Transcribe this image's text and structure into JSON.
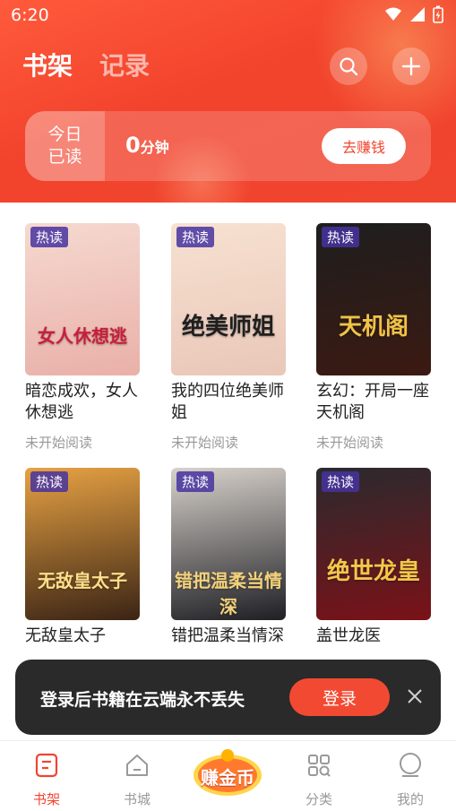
{
  "status_bar": {
    "time": "6:20"
  },
  "header": {
    "tabs": [
      {
        "label": "书架"
      },
      {
        "label": "记录"
      }
    ],
    "today_read": {
      "label_line1": "今日",
      "label_line2": "已读",
      "value": "0",
      "unit": "分钟",
      "earn_button": "去赚钱"
    }
  },
  "books": [
    {
      "title": "暗恋成欢，女人休想逃",
      "status": "未开始阅读",
      "tag": "热读",
      "cover_text": "女人休想逃",
      "cover_colors": [
        "#f5d9cf",
        "#e9b0a9"
      ],
      "cover_text_color": "#c81e3a"
    },
    {
      "title": "我的四位绝美师姐",
      "status": "未开始阅读",
      "tag": "热读",
      "cover_text": "绝美师姐",
      "cover_colors": [
        "#f7e1d1",
        "#e9c7b8"
      ],
      "cover_text_color": "#1f1f1f"
    },
    {
      "title": "玄幻：开局一座天机阁",
      "status": "未开始阅读",
      "tag": "热读",
      "cover_text": "天机阁",
      "cover_colors": [
        "#1e1e1e",
        "#3b1a12"
      ],
      "cover_text_color": "#f0c347"
    },
    {
      "title": "无敌皇太子",
      "status": "",
      "tag": "热读",
      "cover_text": "无敌皇太子",
      "cover_colors": [
        "#e7a243",
        "#3b2415"
      ],
      "cover_text_color": "#ffe08a"
    },
    {
      "title": "错把温柔当情深",
      "status": "",
      "tag": "热读",
      "cover_text": "错把温柔当情深",
      "cover_colors": [
        "#d8d2cb",
        "#1f1f24"
      ],
      "cover_text_color": "#f3d27a"
    },
    {
      "title": "盖世龙医",
      "status": "",
      "tag": "热读",
      "cover_text": "绝世龙皇",
      "cover_colors": [
        "#2a2a2e",
        "#7a1218"
      ],
      "cover_text_color": "#f1c84a"
    }
  ],
  "toast": {
    "message": "登录后书籍在云端永不丢失",
    "login_button": "登录"
  },
  "bottom_nav": [
    {
      "label": "书架",
      "icon": "bookshelf-icon",
      "active": true
    },
    {
      "label": "书城",
      "icon": "home-icon",
      "active": false
    },
    {
      "label": "赚金币",
      "icon": "coin-badge",
      "active": false
    },
    {
      "label": "分类",
      "icon": "category-icon",
      "active": false
    },
    {
      "label": "我的",
      "icon": "profile-icon",
      "active": false
    }
  ],
  "colors": {
    "accent": "#f0452f",
    "toast_bg": "#2a2a2a",
    "hot_tag": "#4632a0"
  }
}
